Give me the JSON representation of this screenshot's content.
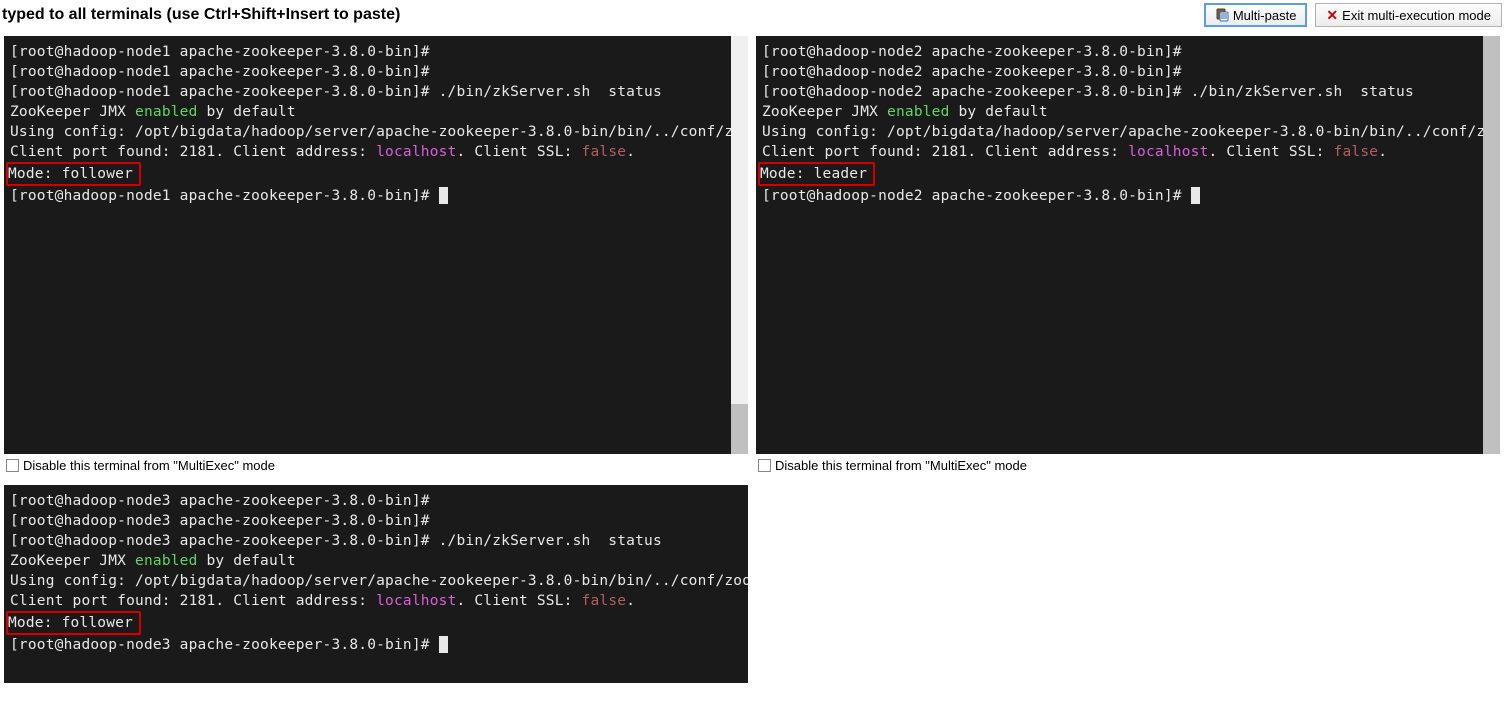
{
  "header": {
    "title": "typed to all terminals (use Ctrl+Shift+Insert to paste)",
    "multipaste_label": "Multi-paste",
    "exit_label": "Exit multi-execution mode"
  },
  "footer_label": "Disable this terminal from \"MultiExec\" mode",
  "colors": {
    "terminal_bg": "#1a1a1a",
    "highlight_border": "#d40000",
    "green": "#5fd75f",
    "purple": "#d75fd7",
    "false": "#af5f5f"
  },
  "terminals": [
    {
      "node": "hadoop-node1",
      "prompt_dir": "apache-zookeeper-3.8.0-bin",
      "command": "./bin/zkServer.sh  status",
      "jmx_pre": "ZooKeeper JMX ",
      "jmx_word": "enabled",
      "jmx_post": " by default",
      "config_line": "Using config: /opt/bigdata/hadoop/server/apache-zookeeper-3.8.0-bin/bin/../conf/zoo.cfg",
      "port_pre": "Client port found: 2181. Client address: ",
      "localhost": "localhost",
      "port_post": ". Client SSL: ",
      "ssl": "false",
      "mode": "Mode: follower",
      "short": false,
      "has_footer": true
    },
    {
      "node": "hadoop-node2",
      "prompt_dir": "apache-zookeeper-3.8.0-bin",
      "command": "./bin/zkServer.sh  status",
      "jmx_pre": "ZooKeeper JMX ",
      "jmx_word": "enabled",
      "jmx_post": " by default",
      "config_line": "Using config: /opt/bigdata/hadoop/server/apache-zookeeper-3.8.0-bin/bin/../conf/zoo.cfg",
      "port_pre": "Client port found: 2181. Client address: ",
      "localhost": "localhost",
      "port_post": ". Client SSL: ",
      "ssl": "false",
      "mode": "Mode: leader",
      "short": false,
      "has_footer": true
    },
    {
      "node": "hadoop-node3",
      "prompt_dir": "apache-zookeeper-3.8.0-bin",
      "command": "./bin/zkServer.sh  status",
      "jmx_pre": "ZooKeeper JMX ",
      "jmx_word": "enabled",
      "jmx_post": " by default",
      "config_line": "Using config: /opt/bigdata/hadoop/server/apache-zookeeper-3.8.0-bin/bin/../conf/zoo.cfg",
      "port_pre": "Client port found: 2181. Client address: ",
      "localhost": "localhost",
      "port_post": ". Client SSL: ",
      "ssl": "false",
      "mode": "Mode: follower",
      "short": true,
      "has_footer": false
    }
  ]
}
